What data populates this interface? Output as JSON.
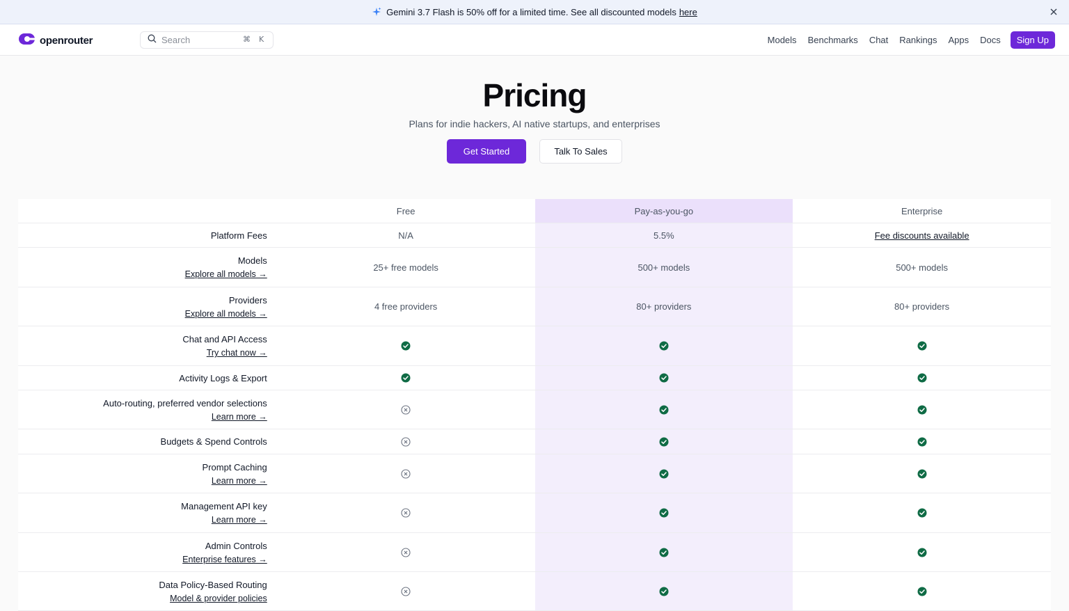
{
  "banner": {
    "text": "Gemini 3.7 Flash is 50% off for a limited time. See all discounted models",
    "link": "here"
  },
  "nav": {
    "logo_text": "openrouter",
    "search_placeholder": "Search",
    "shortcut_cmd": "⌘",
    "shortcut_key": "K",
    "links": [
      "Models",
      "Benchmarks",
      "Chat",
      "Rankings",
      "Apps",
      "Docs"
    ],
    "signup": "Sign Up"
  },
  "hero": {
    "title": "Pricing",
    "subtitle": "Plans for indie hackers, AI native startups, and enterprises",
    "primary_button": "Get Started",
    "secondary_button": "Talk To Sales"
  },
  "table": {
    "plans": [
      "Free",
      "Pay-as-you-go",
      "Enterprise"
    ],
    "rows": [
      {
        "label": "Platform Fees",
        "sub": "",
        "values": [
          {
            "type": "text",
            "text": "N/A"
          },
          {
            "type": "text",
            "text": "5.5%"
          },
          {
            "type": "link",
            "text": "Fee discounts available"
          }
        ]
      },
      {
        "label": "Models",
        "sub": "Explore all models →",
        "values": [
          {
            "type": "text",
            "text": "25+ free models"
          },
          {
            "type": "text",
            "text": "500+ models"
          },
          {
            "type": "text",
            "text": "500+ models"
          }
        ]
      },
      {
        "label": "Providers",
        "sub": "Explore all models →",
        "values": [
          {
            "type": "text",
            "text": "4 free providers"
          },
          {
            "type": "text",
            "text": "80+ providers"
          },
          {
            "type": "text",
            "text": "80+ providers"
          }
        ]
      },
      {
        "label": "Chat and API Access",
        "sub": "Try chat now →",
        "values": [
          {
            "type": "check"
          },
          {
            "type": "check"
          },
          {
            "type": "check"
          }
        ]
      },
      {
        "label": "Activity Logs & Export",
        "sub": "",
        "values": [
          {
            "type": "check"
          },
          {
            "type": "check"
          },
          {
            "type": "check"
          }
        ]
      },
      {
        "label": "Auto-routing, preferred vendor selections",
        "sub": "Learn more →",
        "values": [
          {
            "type": "cross"
          },
          {
            "type": "check"
          },
          {
            "type": "check"
          }
        ]
      },
      {
        "label": "Budgets & Spend Controls",
        "sub": "",
        "values": [
          {
            "type": "cross"
          },
          {
            "type": "check"
          },
          {
            "type": "check"
          }
        ]
      },
      {
        "label": "Prompt Caching",
        "sub": "Learn more →",
        "values": [
          {
            "type": "cross"
          },
          {
            "type": "check"
          },
          {
            "type": "check"
          }
        ]
      },
      {
        "label": "Management API key",
        "sub": "Learn more →",
        "values": [
          {
            "type": "cross"
          },
          {
            "type": "check"
          },
          {
            "type": "check"
          }
        ]
      },
      {
        "label": "Admin Controls",
        "sub": "Enterprise features →",
        "values": [
          {
            "type": "cross"
          },
          {
            "type": "check"
          },
          {
            "type": "check"
          }
        ]
      },
      {
        "label": "Data Policy-Based Routing",
        "sub": "Model & provider policies",
        "values": [
          {
            "type": "cross"
          },
          {
            "type": "check"
          },
          {
            "type": "check"
          }
        ]
      }
    ]
  },
  "colors": {
    "accent": "#6d28d9",
    "check": "#0f6b45",
    "pay_column": "#f3eefc"
  },
  "icons": {
    "banner": "sparkles-icon",
    "close": "close-icon",
    "search": "search-icon",
    "included": "check-circle-icon",
    "excluded": "x-circle-icon"
  }
}
